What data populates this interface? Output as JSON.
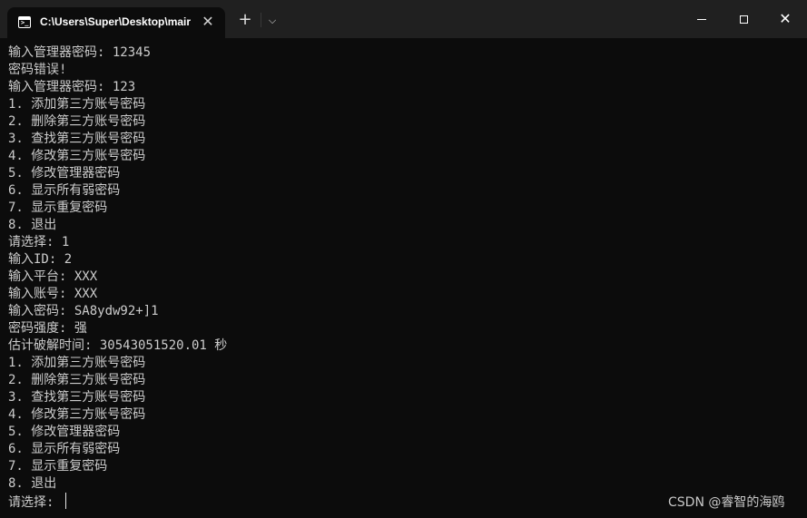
{
  "window": {
    "tab_title": "C:\\Users\\Super\\Desktop\\mair",
    "tab_close": "✕",
    "new_tab": "+",
    "dropdown": "⌵",
    "close": "✕"
  },
  "console": {
    "lines": [
      "输入管理器密码: 12345",
      "密码错误!",
      "输入管理器密码: 123",
      "1. 添加第三方账号密码",
      "2. 删除第三方账号密码",
      "3. 查找第三方账号密码",
      "4. 修改第三方账号密码",
      "5. 修改管理器密码",
      "6. 显示所有弱密码",
      "7. 显示重复密码",
      "8. 退出",
      "请选择: 1",
      "输入ID: 2",
      "输入平台: XXX",
      "输入账号: XXX",
      "输入密码: SA8ydw92+]1",
      "密码强度: 强",
      "估计破解时间: 30543051520.01 秒",
      "1. 添加第三方账号密码",
      "2. 删除第三方账号密码",
      "3. 查找第三方账号密码",
      "4. 修改第三方账号密码",
      "5. 修改管理器密码",
      "6. 显示所有弱密码",
      "7. 显示重复密码",
      "8. 退出"
    ],
    "prompt_line": "请选择: "
  },
  "watermark": "CSDN @睿智的海鸥",
  "colors": {
    "titlebar": "#202020",
    "background": "#0c0c0c",
    "text": "#cccccc"
  }
}
